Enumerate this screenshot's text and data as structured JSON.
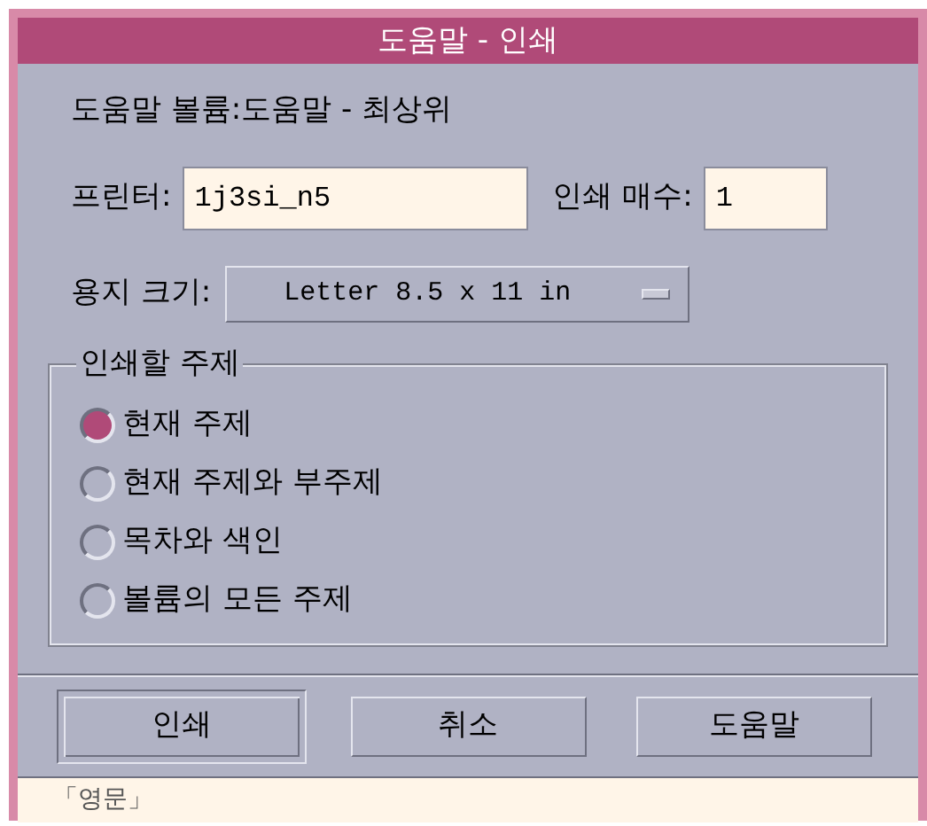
{
  "window": {
    "title": "도움말 - 인쇄"
  },
  "volume_label": "도움말 볼륨:도움말 - 최상위",
  "printer": {
    "label": "프린터:",
    "value": "1j3si_n5"
  },
  "copies": {
    "label": "인쇄 매수:",
    "value": "1"
  },
  "paper_size": {
    "label": "용지 크기:",
    "value": "Letter 8.5 x 11 in"
  },
  "topics": {
    "title": "인쇄할 주제",
    "options": [
      {
        "label": "현재 주제",
        "selected": true
      },
      {
        "label": "현재 주제와 부주제",
        "selected": false
      },
      {
        "label": "목차와 색인",
        "selected": false
      },
      {
        "label": "볼륨의 모든 주제",
        "selected": false
      }
    ]
  },
  "buttons": [
    {
      "label": "인쇄",
      "default": true
    },
    {
      "label": "취소",
      "default": false
    },
    {
      "label": "도움말",
      "default": false
    }
  ],
  "status_bar": {
    "text": "「영문」"
  }
}
